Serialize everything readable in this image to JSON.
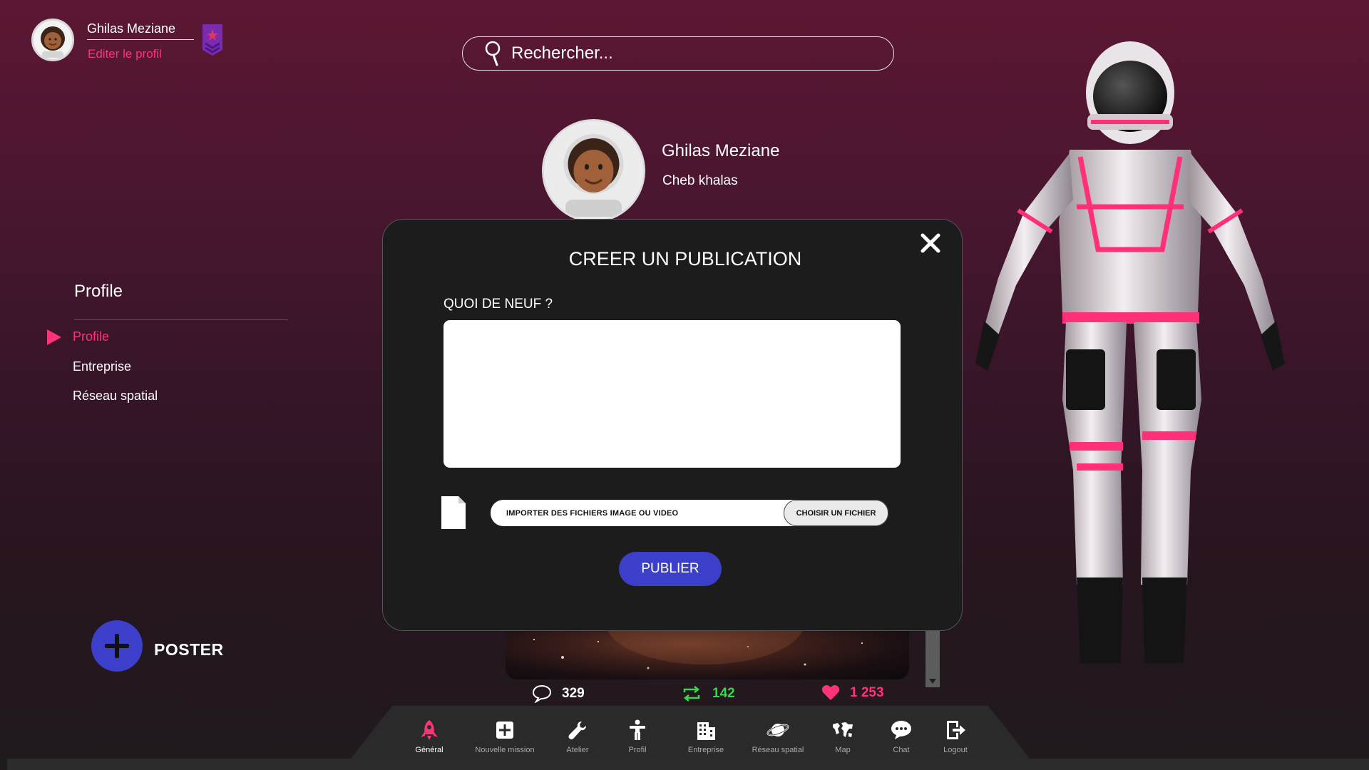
{
  "header": {
    "user_name": "Ghilas Meziane",
    "edit_profile": "Editer le profil",
    "rank_badge_icon": "rank-star-badge"
  },
  "search": {
    "placeholder": "Rechercher..."
  },
  "profile": {
    "name": "Ghilas Meziane",
    "subtitle": "Cheb khalas"
  },
  "sidebar": {
    "title": "Profile",
    "items": [
      {
        "label": "Profile",
        "active": true
      },
      {
        "label": "Entreprise",
        "active": false
      },
      {
        "label": "Réseau spatial",
        "active": false
      }
    ]
  },
  "poster": {
    "label": "POSTER"
  },
  "post_stats": {
    "comments": "329",
    "reposts": "142",
    "likes": "1 253"
  },
  "modal": {
    "title": "CREER UN PUBLICATION",
    "question": "QUOI DE NEUF ?",
    "text_value": "",
    "file_label": "IMPORTER DES FICHIERS IMAGE OU VIDEO",
    "file_button": "CHOISIR UN FICHIER",
    "publish": "PUBLIER"
  },
  "navbar": {
    "items": [
      {
        "label": "Général",
        "icon": "rocket-icon",
        "active": true
      },
      {
        "label": "Nouvelle mission",
        "icon": "plus-square-icon",
        "active": false
      },
      {
        "label": "Atelier",
        "icon": "wrench-icon",
        "active": false
      },
      {
        "label": "Profil",
        "icon": "person-icon",
        "active": false
      },
      {
        "label": "Entreprise",
        "icon": "building-icon",
        "active": false
      },
      {
        "label": "Réseau spatial",
        "icon": "planet-icon",
        "active": false
      },
      {
        "label": "Map",
        "icon": "world-map-icon",
        "active": false
      },
      {
        "label": "Chat",
        "icon": "chat-bubble-icon",
        "active": false
      },
      {
        "label": "Logout",
        "icon": "logout-icon",
        "active": false
      }
    ]
  },
  "colors": {
    "accent_pink": "#ff3377",
    "accent_blue": "#3c3fc9",
    "repost_green": "#39d84a",
    "modal_bg": "#1c1c1c"
  }
}
